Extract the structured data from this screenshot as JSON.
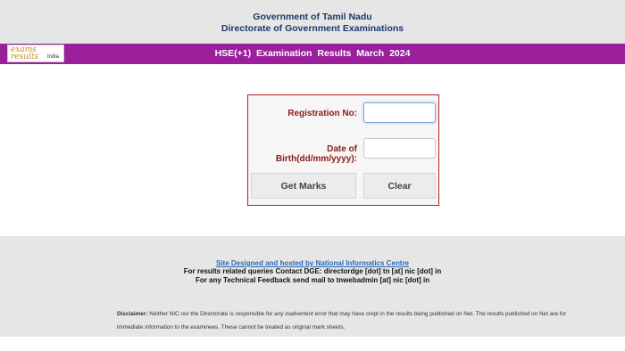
{
  "header": {
    "line1": "Government of Tamil Nadu",
    "line2": "Directorate of Government Examinations"
  },
  "logo": {
    "word1": "exams",
    "word2": "results",
    "word3": "India"
  },
  "banner": {
    "title": "HSE(+1)   Examination Results  March 2024"
  },
  "form": {
    "registration_label": "Registration No:",
    "registration_value": "",
    "dob_label": "Date of Birth(dd/mm/yyyy):",
    "dob_value": "",
    "get_marks_label": "Get Marks",
    "clear_label": "Clear"
  },
  "footer": {
    "site_link": "Site Designed and hosted by National Informatics Centre",
    "contact_line": "For results related queries Contact DGE:  directordge [dot] tn [at] nic [dot] in",
    "feedback_line": "For any Technical Feedback send mail to tnwebadmin [at] nic [dot] in",
    "disclaimer_label": "Disclaimer:",
    "disclaimer_text": " Neither NIC nor the Directorate is responsible for any inadvertent error that may have crept in the results being published on Net. The results published on Net are for immediate information to the examinees. These cannot be treated as original mark sheets."
  },
  "colors": {
    "banner": "#9b1e9b",
    "header_text": "#1a3a6a",
    "label_text": "#8b1a1a",
    "box_border": "#b22222",
    "link": "#2a6ab8"
  }
}
